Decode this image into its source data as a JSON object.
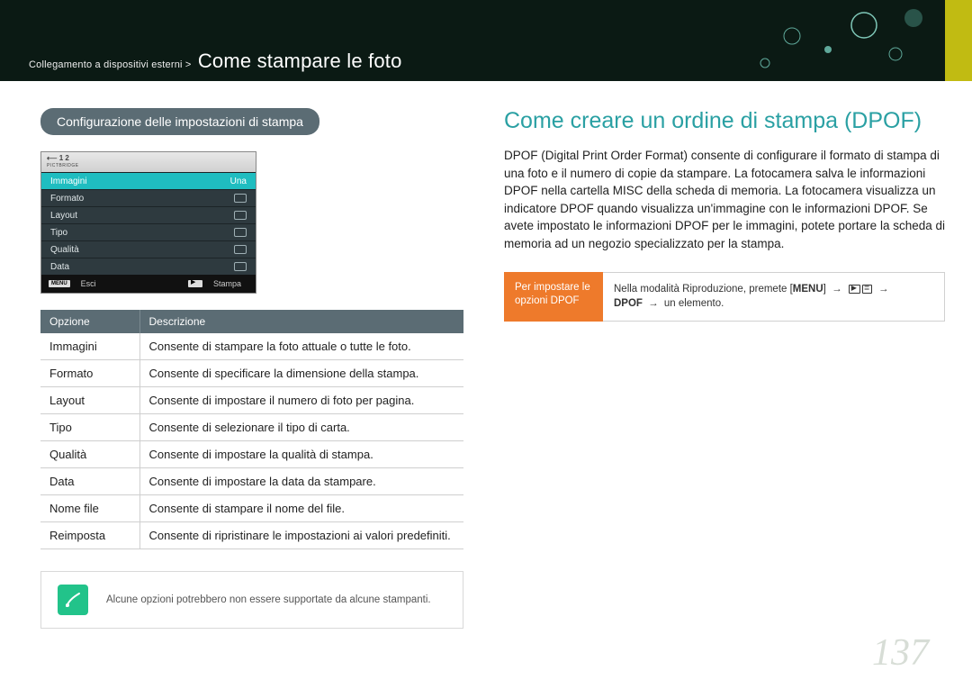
{
  "breadcrumb": {
    "path": "Collegamento a dispositivi esterni >",
    "title": "Come stampare le foto"
  },
  "left": {
    "section_pill": "Configurazione delle impostazioni di stampa",
    "lcd": {
      "pictbridge": "PICTBRIDGE",
      "rows": [
        {
          "label": "Immagini",
          "value": "Una",
          "selected": true
        },
        {
          "label": "Formato",
          "value": "",
          "selected": false
        },
        {
          "label": "Layout",
          "value": "",
          "selected": false
        },
        {
          "label": "Tipo",
          "value": "",
          "selected": false
        },
        {
          "label": "Qualità",
          "value": "",
          "selected": false
        },
        {
          "label": "Data",
          "value": "",
          "selected": false
        }
      ],
      "foot_exit_key": "MENU",
      "foot_exit": "Esci",
      "foot_print": "Stampa"
    },
    "table": {
      "head_option": "Opzione",
      "head_desc": "Descrizione",
      "rows": [
        {
          "opt": "Immagini",
          "desc": "Consente di stampare la foto attuale o tutte le foto."
        },
        {
          "opt": "Formato",
          "desc": "Consente di specificare la dimensione della stampa."
        },
        {
          "opt": "Layout",
          "desc": "Consente di impostare il numero di foto per pagina."
        },
        {
          "opt": "Tipo",
          "desc": "Consente di selezionare il tipo di carta."
        },
        {
          "opt": "Qualità",
          "desc": "Consente di impostare la qualità di stampa."
        },
        {
          "opt": "Data",
          "desc": "Consente di impostare la data da stampare."
        },
        {
          "opt": "Nome file",
          "desc": "Consente di stampare il nome del file."
        },
        {
          "opt": "Reimposta",
          "desc": "Consente di ripristinare le impostazioni ai valori predefiniti."
        }
      ]
    },
    "note": "Alcune opzioni potrebbero non essere supportate da alcune stampanti."
  },
  "right": {
    "heading": "Come creare un ordine di stampa (DPOF)",
    "body": "DPOF (Digital Print Order Format) consente di configurare il formato di stampa di una foto e il numero di copie da stampare. La fotocamera salva le informazioni DPOF nella cartella MISC della scheda di memoria. La fotocamera visualizza un indicatore DPOF quando visualizza un'immagine con le informazioni DPOF. Se avete impostato le informazioni DPOF per le immagini, potete portare la scheda di memoria ad un negozio specializzato per la stampa.",
    "instr_title": "Per impostare le opzioni DPOF",
    "instr_text_prefix": "Nella modalità Riproduzione, premete [",
    "instr_menu": "MENU",
    "instr_text_mid": "] ",
    "instr_arrow": "→",
    "instr_dpof": "DPOF",
    "instr_suffix": " un elemento."
  },
  "page_number": "137"
}
